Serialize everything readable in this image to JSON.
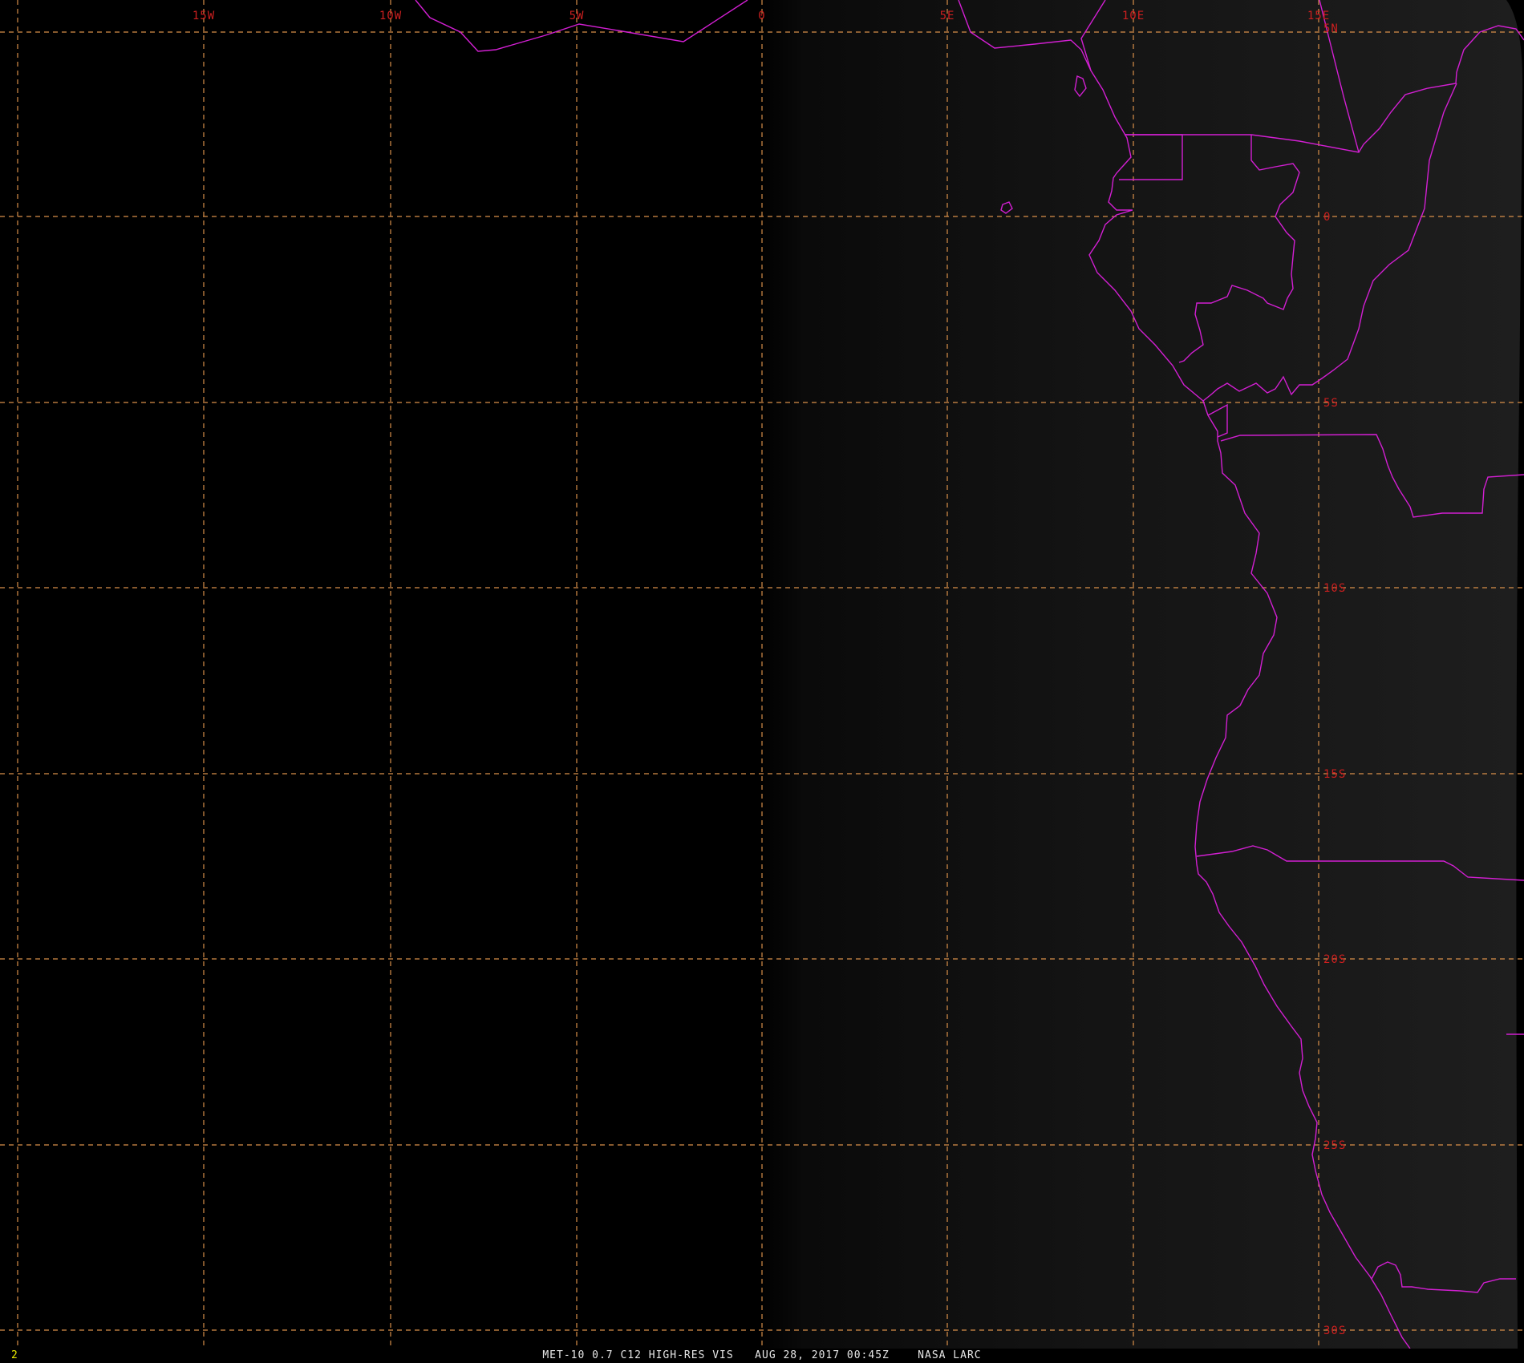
{
  "map": {
    "longitude_labels": [
      "15W",
      "10W",
      "5W",
      "0",
      "5E",
      "10E",
      "15E"
    ],
    "latitude_labels": [
      "5N",
      "0",
      "5S",
      "10S",
      "15S",
      "20S",
      "25S",
      "30S"
    ],
    "colors": {
      "background": "#000000",
      "grid_lines": "#d9904a",
      "grid_labels": "#cc1f1f",
      "boundaries": "#d21fd2",
      "footer_text": "#e6e6e6",
      "frame_number": "#e8e800"
    }
  },
  "footer": {
    "frame_number": "2",
    "caption": "MET-10 0.7 C12 HIGH-RES VIS   AUG 28, 2017 00:45Z    NASA LARC"
  }
}
